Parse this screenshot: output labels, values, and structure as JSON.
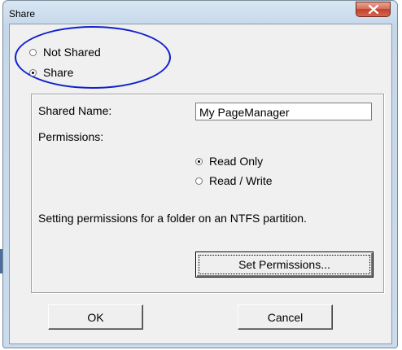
{
  "window": {
    "title": "Share",
    "close_glyph": "×"
  },
  "sharing": {
    "not_shared_label": "Not Shared",
    "share_label": "Share",
    "selected": "Share"
  },
  "share_details": {
    "shared_name_label": "Shared Name:",
    "shared_name_value": "My PageManager",
    "permissions_label": "Permissions:",
    "read_only_label": "Read Only",
    "read_write_label": "Read / Write",
    "selected_permission": "Read Only",
    "ntfs_note": "Setting permissions for a folder on an NTFS partition.",
    "set_permissions_label": "Set Permissions..."
  },
  "footer": {
    "ok_label": "OK",
    "cancel_label": "Cancel"
  },
  "colors": {
    "annotation_oval": "#1122cc",
    "close_button": "#c2412b",
    "dialog_face": "#f0f0f0"
  }
}
